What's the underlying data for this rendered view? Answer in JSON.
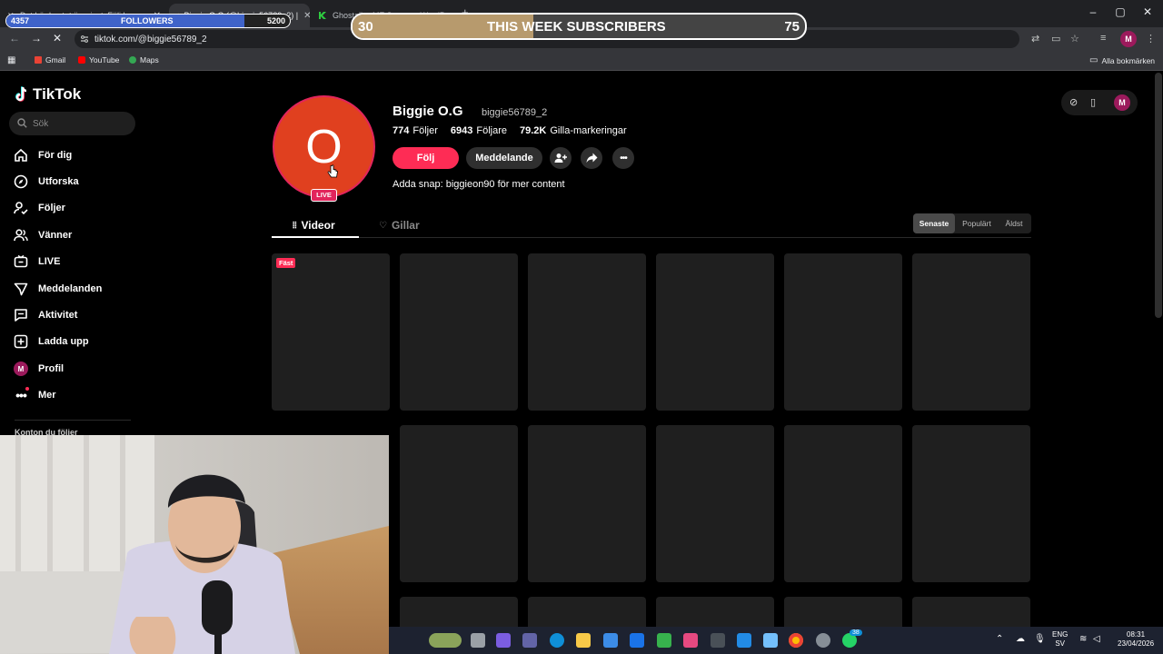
{
  "browser": {
    "tabs": [
      {
        "label": "Det här kontot är privat. Följ k..."
      },
      {
        "label": "Biggie O.G (@biggie56789_2) |"
      },
      {
        "label": "Ghostalb - MF Stream - WordP..."
      }
    ],
    "url": "tiktok.com/@biggie56789_2",
    "bookmarks": [
      "Gmail",
      "YouTube",
      "Maps"
    ],
    "all_bookmarks": "Alla bokmärken",
    "profile_initial": "M"
  },
  "overlay": {
    "followers_label": "FOLLOWERS",
    "followers_current": "4357",
    "followers_goal": "5200",
    "followers_progress": 0.84,
    "subs_label": "THIS WEEK SUBSCRIBERS",
    "subs_current": "30",
    "subs_goal": "75",
    "subs_progress": 0.4
  },
  "sidebar": {
    "logo": "TikTok",
    "search_placeholder": "Sök",
    "items": [
      {
        "label": "För dig",
        "icon": "home-icon"
      },
      {
        "label": "Utforska",
        "icon": "compass-icon"
      },
      {
        "label": "Följer",
        "icon": "user-follow-icon"
      },
      {
        "label": "Vänner",
        "icon": "friends-icon"
      },
      {
        "label": "LIVE",
        "icon": "live-icon"
      },
      {
        "label": "Meddelanden",
        "icon": "messages-icon"
      },
      {
        "label": "Aktivitet",
        "icon": "activity-icon"
      },
      {
        "label": "Ladda upp",
        "icon": "upload-icon"
      },
      {
        "label": "Profil",
        "icon": "profile-icon"
      },
      {
        "label": "Mer",
        "icon": "more-icon"
      }
    ],
    "profile_initial": "M",
    "following_accounts_title": "Konton du följer"
  },
  "profile": {
    "avatar_letter": "O",
    "live_badge": "LIVE",
    "name": "Biggie O.G",
    "handle": "biggie56789_2",
    "following_count": "774",
    "following_label": "Följer",
    "followers_count": "6943",
    "followers_label": "Följare",
    "likes_count": "79.2K",
    "likes_label": "Gilla-markeringar",
    "follow_button": "Följ",
    "message_button": "Meddelande",
    "bio": "Adda snap: biggieon90 för mer content",
    "tabs": [
      {
        "label": "Videor"
      },
      {
        "label": "Gillar"
      }
    ],
    "sort_options": [
      {
        "label": "Senaste"
      },
      {
        "label": "Populärt"
      },
      {
        "label": "Äldst"
      }
    ],
    "pinned_label": "Fäst",
    "topright_initial": "M"
  },
  "taskbar": {
    "lang_top": "ENG",
    "lang_bottom": "SV",
    "time": "08:31",
    "date": "23/04/2026",
    "notification_count": "38"
  }
}
